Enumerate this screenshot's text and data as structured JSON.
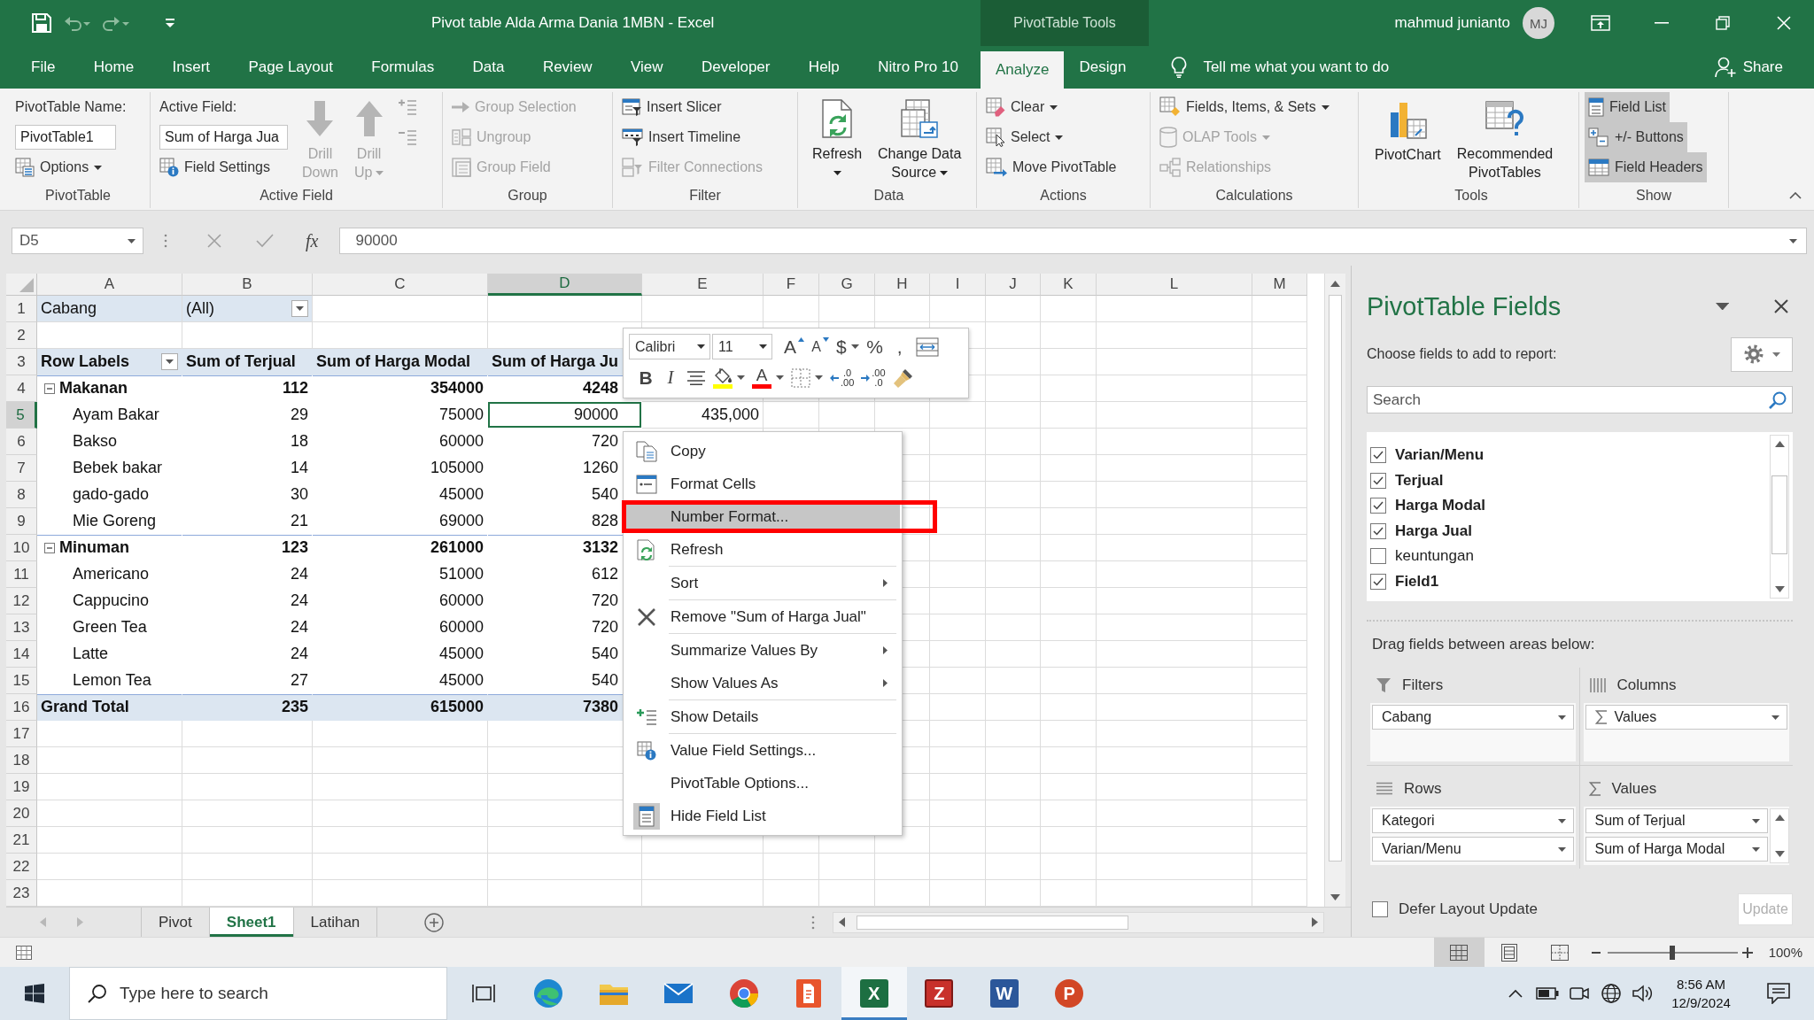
{
  "title_bar": {
    "quick_access": [
      {
        "kind": "save",
        "disabled": false
      },
      {
        "kind": "undo",
        "disabled": true
      },
      {
        "kind": "redo",
        "disabled": true
      },
      {
        "kind": "customize",
        "disabled": false
      }
    ],
    "title": "Pivot table Alda Arma Dania 1MBN - Excel",
    "context_label": "PivotTable Tools",
    "user": "mahmud junianto",
    "initials": "MJ"
  },
  "tabs": [
    {
      "label": "File",
      "selected": false,
      "contextual": false
    },
    {
      "label": "Home",
      "selected": false,
      "contextual": false
    },
    {
      "label": "Insert",
      "selected": false,
      "contextual": false
    },
    {
      "label": "Page Layout",
      "selected": false,
      "contextual": false
    },
    {
      "label": "Formulas",
      "selected": false,
      "contextual": false
    },
    {
      "label": "Data",
      "selected": false,
      "contextual": false
    },
    {
      "label": "Review",
      "selected": false,
      "contextual": false
    },
    {
      "label": "View",
      "selected": false,
      "contextual": false
    },
    {
      "label": "Developer",
      "selected": false,
      "contextual": false
    },
    {
      "label": "Help",
      "selected": false,
      "contextual": false
    },
    {
      "label": "Nitro Pro 10",
      "selected": false,
      "contextual": false
    },
    {
      "label": "Analyze",
      "selected": true,
      "contextual": true
    },
    {
      "label": "Design",
      "selected": false,
      "contextual": true
    }
  ],
  "tell_me": {
    "placeholder": "Tell me what you want to do"
  },
  "share": "Share",
  "ribbon": {
    "groups": [
      {
        "label": "PivotTable",
        "columns": [
          {
            "kind": "stack",
            "items": [
              {
                "kind": "caption",
                "label": "PivotTable Name:"
              },
              {
                "kind": "input",
                "value": "PivotTable1"
              },
              {
                "kind": "options",
                "label": "Options",
                "dropdown": true,
                "disabled": false
              }
            ]
          }
        ]
      },
      {
        "label": "Active Field",
        "columns": [
          {
            "kind": "stack",
            "items": [
              {
                "kind": "caption",
                "label": "Active Field:"
              },
              {
                "kind": "input",
                "value": "Sum of Harga Jua"
              },
              {
                "kind": "field_settings",
                "label": "Field Settings",
                "dropdown": false,
                "disabled": false
              }
            ]
          },
          {
            "kind": "large",
            "items": [
              {
                "kind": "drill_down",
                "lines": [
                  "Drill",
                  "Down"
                ],
                "dropdown": false,
                "disabled": true
              }
            ]
          },
          {
            "kind": "large",
            "items": [
              {
                "kind": "drill_up",
                "lines": [
                  "Drill",
                  "Up"
                ],
                "dropdown": true,
                "disabled": true
              }
            ]
          },
          {
            "kind": "stack",
            "items": [
              {
                "kind": "expand_field",
                "dropdown": false,
                "disabled": true
              },
              {
                "kind": "collapse_field",
                "dropdown": false,
                "disabled": true
              }
            ]
          }
        ]
      },
      {
        "label": "Group",
        "columns": [
          {
            "kind": "stack",
            "items": [
              {
                "kind": "group_selection",
                "label": "Group Selection",
                "dropdown": false,
                "disabled": true
              },
              {
                "kind": "ungroup",
                "label": "Ungroup",
                "dropdown": false,
                "disabled": true
              },
              {
                "kind": "group_field",
                "label": "Group Field",
                "dropdown": false,
                "disabled": true
              }
            ]
          }
        ]
      },
      {
        "label": "Filter",
        "columns": [
          {
            "kind": "stack",
            "items": [
              {
                "kind": "slicer",
                "label": "Insert Slicer",
                "dropdown": false,
                "disabled": false
              },
              {
                "kind": "timeline",
                "label": "Insert Timeline",
                "dropdown": false,
                "disabled": false
              },
              {
                "kind": "connections",
                "label": "Filter Connections",
                "dropdown": false,
                "disabled": true
              }
            ]
          }
        ]
      },
      {
        "label": "Data",
        "columns": [
          {
            "kind": "large",
            "items": [
              {
                "kind": "refresh",
                "lines": [
                  "Refresh"
                ],
                "dropdown": true,
                "disabled": false
              }
            ]
          },
          {
            "kind": "large",
            "items": [
              {
                "kind": "change_source",
                "lines": [
                  "Change Data",
                  "Source"
                ],
                "dropdown": true,
                "disabled": false
              }
            ]
          }
        ]
      },
      {
        "label": "Actions",
        "columns": [
          {
            "kind": "stack",
            "items": [
              {
                "kind": "clear",
                "label": "Clear",
                "dropdown": true,
                "disabled": false
              },
              {
                "kind": "select",
                "label": "Select",
                "dropdown": true,
                "disabled": false
              },
              {
                "kind": "move",
                "label": "Move PivotTable",
                "dropdown": false,
                "disabled": false
              }
            ]
          }
        ]
      },
      {
        "label": "Calculations",
        "columns": [
          {
            "kind": "stack",
            "items": [
              {
                "kind": "fields_items",
                "label": "Fields, Items, & Sets",
                "dropdown": true,
                "disabled": false
              },
              {
                "kind": "olap",
                "label": "OLAP Tools",
                "dropdown": true,
                "disabled": true
              },
              {
                "kind": "relationships",
                "label": "Relationships",
                "dropdown": false,
                "disabled": true
              }
            ]
          }
        ]
      },
      {
        "label": "Tools",
        "columns": [
          {
            "kind": "large",
            "items": [
              {
                "kind": "pivotchart",
                "lines": [
                  "PivotChart"
                ],
                "dropdown": false,
                "disabled": false
              }
            ]
          },
          {
            "kind": "large",
            "items": [
              {
                "kind": "recommended",
                "lines": [
                  "Recommended",
                  "PivotTables"
                ],
                "dropdown": false,
                "disabled": false
              }
            ]
          }
        ]
      },
      {
        "label": "Show",
        "columns": [
          {
            "kind": "toggles",
            "items": [
              {
                "kind": "field_list",
                "label": "Field List",
                "on": true
              },
              {
                "kind": "plus_minus",
                "label": "+/- Buttons",
                "on": true
              },
              {
                "kind": "field_headers",
                "label": "Field Headers",
                "on": true
              }
            ]
          }
        ]
      }
    ]
  },
  "formula_bar": {
    "name_box": "D5",
    "function_label": "fx",
    "formula": "90000"
  },
  "sheet": {
    "columns": [
      {
        "label": "A",
        "selected": false
      },
      {
        "label": "B",
        "selected": false
      },
      {
        "label": "C",
        "selected": false
      },
      {
        "label": "D",
        "selected": true
      },
      {
        "label": "E",
        "selected": false
      },
      {
        "label": "F",
        "selected": false
      },
      {
        "label": "G",
        "selected": false
      },
      {
        "label": "H",
        "selected": false
      },
      {
        "label": "I",
        "selected": false
      },
      {
        "label": "J",
        "selected": false
      },
      {
        "label": "K",
        "selected": false
      },
      {
        "label": "L",
        "selected": false
      },
      {
        "label": "M",
        "selected": false
      }
    ],
    "rows": [
      {
        "number": "1",
        "selected": false,
        "kind": "filter",
        "cells": [
          "Cabang",
          "(All)"
        ]
      },
      {
        "number": "2",
        "selected": false,
        "kind": "blank"
      },
      {
        "number": "3",
        "selected": false,
        "kind": "header",
        "cells": [
          "Row Labels",
          "Sum of Terjual",
          "Sum of Harga Modal",
          "Sum of Harga Ju"
        ]
      },
      {
        "number": "4",
        "selected": false,
        "kind": "group",
        "expanded": true,
        "cells": [
          "Makanan",
          "112",
          "354000",
          "4248"
        ]
      },
      {
        "number": "5",
        "selected": true,
        "kind": "item",
        "cells": [
          "Ayam Bakar",
          "29",
          "75000",
          "90000",
          "435,000"
        ]
      },
      {
        "number": "6",
        "selected": false,
        "kind": "item",
        "cells": [
          "Bakso",
          "18",
          "60000",
          "720"
        ]
      },
      {
        "number": "7",
        "selected": false,
        "kind": "item",
        "cells": [
          "Bebek bakar",
          "14",
          "105000",
          "1260"
        ]
      },
      {
        "number": "8",
        "selected": false,
        "kind": "item",
        "cells": [
          "gado-gado",
          "30",
          "45000",
          "540"
        ]
      },
      {
        "number": "9",
        "selected": false,
        "kind": "item",
        "cells": [
          "Mie Goreng",
          "21",
          "69000",
          "828"
        ]
      },
      {
        "number": "10",
        "selected": false,
        "kind": "group",
        "expanded": true,
        "cells": [
          "Minuman",
          "123",
          "261000",
          "3132"
        ]
      },
      {
        "number": "11",
        "selected": false,
        "kind": "item",
        "cells": [
          "Americano",
          "24",
          "51000",
          "612"
        ]
      },
      {
        "number": "12",
        "selected": false,
        "kind": "item",
        "cells": [
          "Cappucino",
          "24",
          "60000",
          "720"
        ]
      },
      {
        "number": "13",
        "selected": false,
        "kind": "item",
        "cells": [
          "Green Tea",
          "24",
          "60000",
          "720"
        ]
      },
      {
        "number": "14",
        "selected": false,
        "kind": "item",
        "cells": [
          "Latte",
          "24",
          "45000",
          "540"
        ]
      },
      {
        "number": "15",
        "selected": false,
        "kind": "item",
        "cells": [
          "Lemon Tea",
          "27",
          "45000",
          "540"
        ]
      },
      {
        "number": "16",
        "selected": false,
        "kind": "total",
        "cells": [
          "Grand Total",
          "235",
          "615000",
          "7380"
        ]
      },
      {
        "number": "17",
        "selected": false,
        "kind": "blank"
      },
      {
        "number": "18",
        "selected": false,
        "kind": "blank"
      },
      {
        "number": "19",
        "selected": false,
        "kind": "blank"
      },
      {
        "number": "20",
        "selected": false,
        "kind": "blank"
      },
      {
        "number": "21",
        "selected": false,
        "kind": "blank"
      },
      {
        "number": "22",
        "selected": false,
        "kind": "blank"
      },
      {
        "number": "23",
        "selected": false,
        "kind": "blank"
      }
    ]
  },
  "mini_toolbar": {
    "font": "Calibri",
    "size": "11",
    "rows": [
      [
        {
          "kind": "grow",
          "label": "A",
          "dropdown": false
        },
        {
          "kind": "shrink",
          "label": "A",
          "dropdown": false
        },
        {
          "kind": "currency",
          "label": "$",
          "dropdown": true
        },
        {
          "kind": "percent",
          "label": "%",
          "dropdown": false
        },
        {
          "kind": "comma",
          "label": ",",
          "dropdown": false
        },
        {
          "kind": "merge",
          "dropdown": false
        }
      ],
      [
        {
          "kind": "bold",
          "label": "B",
          "dropdown": false
        },
        {
          "kind": "italic",
          "label": "I",
          "dropdown": false
        },
        {
          "kind": "center",
          "dropdown": false
        },
        {
          "kind": "fill",
          "color": "#ffff00",
          "dropdown": true
        },
        {
          "kind": "fontcolor",
          "label": "A",
          "color": "#ff0000",
          "dropdown": true
        },
        {
          "kind": "borders",
          "dropdown": true
        },
        {
          "kind": "increase_decimal",
          "lines": [
            ".0",
            ".00"
          ],
          "dropdown": false
        },
        {
          "kind": "decrease_decimal",
          "lines": [
            ".00",
            ".0"
          ],
          "dropdown": false
        },
        {
          "kind": "painter",
          "dropdown": false
        }
      ]
    ]
  },
  "context_menu": {
    "sections": [
      [
        {
          "kind": "copy",
          "label": "Copy",
          "submenu": false,
          "highlighted": false,
          "outlined": false
        },
        {
          "kind": "format",
          "label": "Format Cells",
          "submenu": false,
          "highlighted": false,
          "outlined": false
        },
        {
          "kind": "plain",
          "label": "Number Format...",
          "submenu": false,
          "highlighted": true,
          "outlined": true
        },
        {
          "kind": "refresh",
          "label": "Refresh",
          "submenu": false,
          "highlighted": false,
          "outlined": false
        }
      ],
      [
        {
          "kind": "plain",
          "label": "Sort",
          "submenu": true,
          "highlighted": false,
          "outlined": false
        }
      ],
      [
        {
          "kind": "remove",
          "label": "Remove \"Sum of Harga Jual\"",
          "submenu": false,
          "highlighted": false,
          "outlined": false
        }
      ],
      [
        {
          "kind": "plain",
          "label": "Summarize Values By",
          "submenu": true,
          "highlighted": false,
          "outlined": false
        },
        {
          "kind": "plain",
          "label": "Show Values As",
          "submenu": true,
          "highlighted": false,
          "outlined": false
        }
      ],
      [
        {
          "kind": "details",
          "label": "Show Details",
          "submenu": false,
          "highlighted": false,
          "outlined": false
        }
      ],
      [
        {
          "kind": "settings",
          "label": "Value Field Settings...",
          "submenu": false,
          "highlighted": false,
          "outlined": false
        },
        {
          "kind": "plain",
          "label": "PivotTable Options...",
          "submenu": false,
          "highlighted": false,
          "outlined": false
        },
        {
          "kind": "fieldlist",
          "label": "Hide Field List",
          "submenu": false,
          "highlighted": false,
          "outlined": false
        }
      ]
    ]
  },
  "field_pane": {
    "title": "PivotTable Fields",
    "subtitle": "Choose fields to add to report:",
    "search": {
      "placeholder": "Search"
    },
    "fields": [
      {
        "label": "Varian/Menu",
        "checked": true
      },
      {
        "label": "Terjual",
        "checked": true
      },
      {
        "label": "Harga Modal",
        "checked": true
      },
      {
        "label": "Harga Jual",
        "checked": true
      },
      {
        "label": "keuntungan",
        "checked": false
      },
      {
        "label": "Field1",
        "checked": true
      }
    ],
    "areas_hint": "Drag fields between areas below:",
    "areas": [
      {
        "kind": "filters",
        "title": "Filters",
        "items": [
          {
            "kind": "field",
            "label": "Cabang"
          }
        ]
      },
      {
        "kind": "columns",
        "title": "Columns",
        "items": [
          {
            "kind": "values",
            "label": "Values"
          }
        ]
      },
      {
        "kind": "rows",
        "title": "Rows",
        "items": [
          {
            "kind": "field",
            "label": "Kategori"
          },
          {
            "kind": "field",
            "label": "Varian/Menu"
          }
        ]
      },
      {
        "kind": "values",
        "title": "Values",
        "items": [
          {
            "kind": "field",
            "label": "Sum of Terjual"
          },
          {
            "kind": "field",
            "label": "Sum of Harga Modal"
          }
        ]
      }
    ],
    "defer": {
      "label": "Defer Layout Update",
      "checked": false
    },
    "update": {
      "label": "Update",
      "disabled": true
    }
  },
  "sheet_tabs": [
    {
      "label": "Pivot",
      "selected": false
    },
    {
      "label": "Sheet1",
      "selected": true
    },
    {
      "label": "Latihan",
      "selected": false
    }
  ],
  "status_bar": {
    "views": [
      {
        "kind": "normal",
        "selected": true
      },
      {
        "kind": "layout",
        "selected": false
      },
      {
        "kind": "pagebreak",
        "selected": false
      }
    ],
    "zoom": {
      "level": 0.5,
      "reading": "100%"
    }
  },
  "taskbar": {
    "search": {
      "placeholder": "Type here to search"
    },
    "apps": [
      {
        "kind": "taskview",
        "active": false
      },
      {
        "kind": "browser",
        "active": false
      },
      {
        "kind": "folder",
        "active": false
      },
      {
        "kind": "mail",
        "active": false
      },
      {
        "kind": "wheel",
        "active": false
      },
      {
        "kind": "pdf",
        "active": false
      },
      {
        "kind": "sheet",
        "glyph": "X",
        "active": true
      },
      {
        "kind": "archive",
        "glyph": "Z",
        "active": false
      },
      {
        "kind": "doc",
        "glyph": "W",
        "active": false
      },
      {
        "kind": "slides",
        "glyph": "P",
        "active": false
      }
    ],
    "tray": [
      {
        "kind": "chevron"
      },
      {
        "kind": "battery"
      },
      {
        "kind": "camera"
      },
      {
        "kind": "globe"
      },
      {
        "kind": "volume"
      }
    ],
    "time": "8:56 AM",
    "date": "12/9/2024"
  }
}
